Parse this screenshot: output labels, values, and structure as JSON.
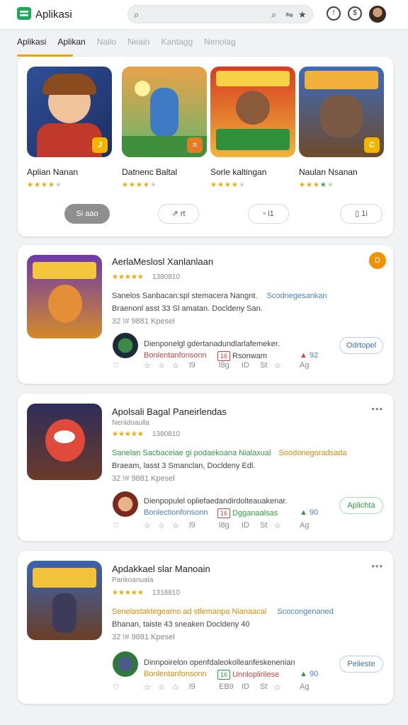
{
  "header": {
    "app_name": "Aplikasi",
    "search_placeholder": "",
    "icons": [
      "search-icon",
      "search-icon",
      "share-icon",
      "star-icon",
      "history-icon",
      "settings-icon"
    ]
  },
  "tabs": [
    "Aplikasi",
    "Aplikan",
    "Nailo",
    "Neain",
    "Kantagg",
    "Nenolag"
  ],
  "featured": {
    "items": [
      {
        "name": "Aplian Nanan",
        "rating": 4,
        "color_a": "#f5c65a",
        "color_b": "#3c5fa8"
      },
      {
        "name": "Datnenc Baltal",
        "rating": 4,
        "color_a": "#f08b3a",
        "color_b": "#5bb0d9"
      },
      {
        "name": "Sorle kaltingan",
        "rating": 4,
        "color_a": "#e0362b",
        "color_b": "#f5b93a"
      },
      {
        "name": "Naulan Nsanan",
        "rating": 4,
        "color_a": "#3466b8",
        "color_b": "#f2a23a"
      }
    ],
    "pills": [
      "Si aao",
      "rt",
      "i1",
      "1i"
    ]
  },
  "apps": [
    {
      "title": "AerlaMeslosl Xanlanlaan",
      "stars": "★★★★★",
      "score": "1380810",
      "line1_a": "Sanelos Sanbacan:spl stemacera Nangnt.",
      "line1_b": "Scodnegesankan",
      "line2": "Braenonl asst 33 Sl amatan. Docldeny San.",
      "meta": "32 !# 9881  Kpesel",
      "dev": "Dienponelgl gdertanadundlarlafemeker.",
      "dev_sub": "Bonlentanfonsonn",
      "dev_tag": "Rsonwam",
      "dev_num": "92",
      "foot": [
        "9",
        "☆",
        "☆",
        "l9",
        "l8g",
        "ID",
        "St",
        "☆",
        "Ag"
      ],
      "action": "Odrtopel",
      "badge": "D",
      "accent": "blue"
    },
    {
      "title": "Apolsali Bagal Paneirlendas",
      "stars": "★★★★★",
      "score": "1380810",
      "line1_a": "Sanelan Sacbaceiae gi podaekoana Nialaxual",
      "line1_b": "Soodonegoradsada",
      "line2": "Braeam, lasst 3 Smanclan, Docldeny Edl.",
      "meta": "32 !# 9881  Kpesel",
      "dev": "Dienpopulel opliefaedandirdolteauakenar.",
      "dev_sub": "Bonlectionfonsonn",
      "dev_tag": "Dgganaalsas",
      "dev_num": "90",
      "foot": [
        "9",
        "☆",
        "☆",
        "l9",
        "l8g",
        "ID",
        "St",
        "☆",
        "Ag"
      ],
      "action": "Aplichta",
      "badge": "",
      "accent": "green"
    },
    {
      "title": "Apdakkael slar Manoain",
      "stars": "★★★★★",
      "score": "1318810",
      "line1_a": "Senelastaktegeamo ad stlemanpa Nianaacal",
      "line1_b": "Scocongenaned",
      "line2": "Bhanan, taiste 43 sneaken Docldeny 40",
      "meta": "32 !# 9881  Kpesel",
      "dev": "Dinnpoirelon openfdaleokolleanfeskenenian",
      "dev_sub": "Bonlentanfonsonn",
      "dev_tag": "Unnloplirilese",
      "dev_num": "90",
      "foot": [
        "9",
        "☆",
        "☆",
        "l9",
        "EB9",
        "ID",
        "St",
        "☆",
        "Ag"
      ],
      "action": "Pelieste",
      "badge": "",
      "accent": "blue"
    }
  ]
}
